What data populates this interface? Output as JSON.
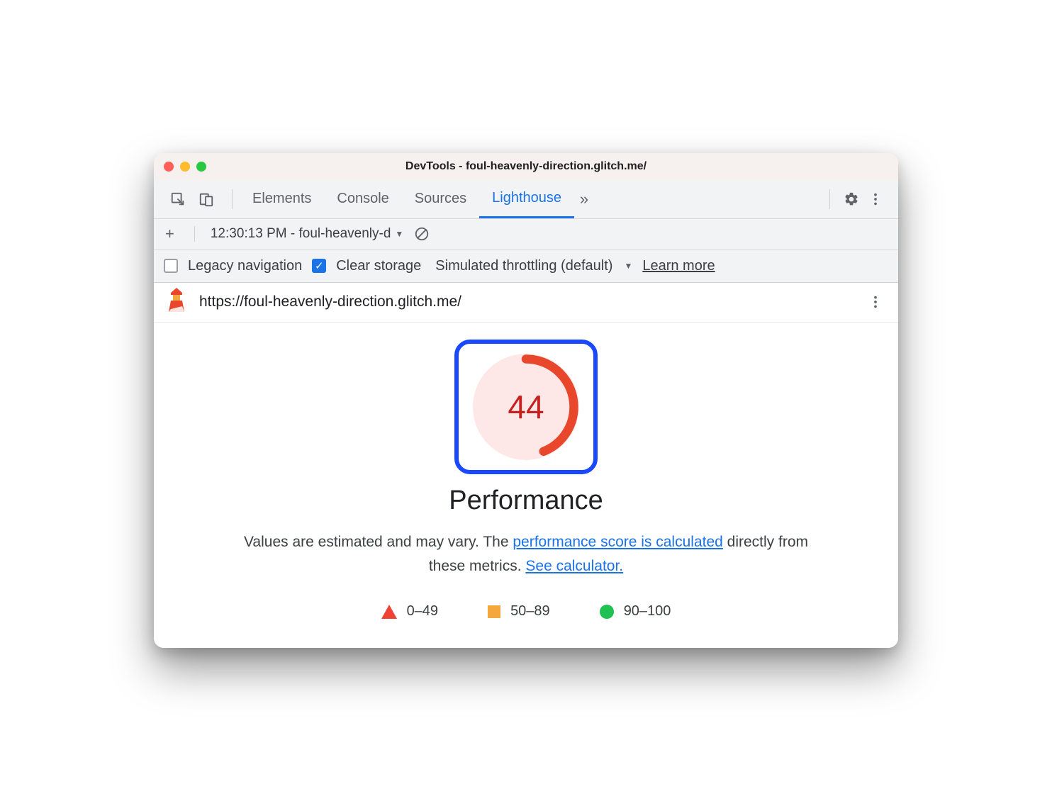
{
  "window": {
    "title": "DevTools - foul-heavenly-direction.glitch.me/"
  },
  "tabs": {
    "items": [
      "Elements",
      "Console",
      "Sources",
      "Lighthouse"
    ],
    "active_index": 3
  },
  "toolbar": {
    "report_selector": "12:30:13 PM - foul-heavenly-d"
  },
  "options": {
    "legacy_label": "Legacy navigation",
    "legacy_checked": false,
    "clear_label": "Clear storage",
    "clear_checked": true,
    "throttle_label": "Simulated throttling (default)",
    "learn_more": "Learn more"
  },
  "report": {
    "url": "https://foul-heavenly-direction.glitch.me/",
    "score": 44,
    "category": "Performance",
    "desc_pre": "Values are estimated and may vary. The ",
    "desc_link1": "performance score is calculated",
    "desc_mid": " directly from these metrics. ",
    "desc_link2": "See calculator.",
    "legend": {
      "poor": "0–49",
      "avg": "50–89",
      "good": "90–100"
    }
  },
  "colors": {
    "fail": "#c5221f",
    "highlight": "#1948ff",
    "link": "#1a73e8"
  }
}
